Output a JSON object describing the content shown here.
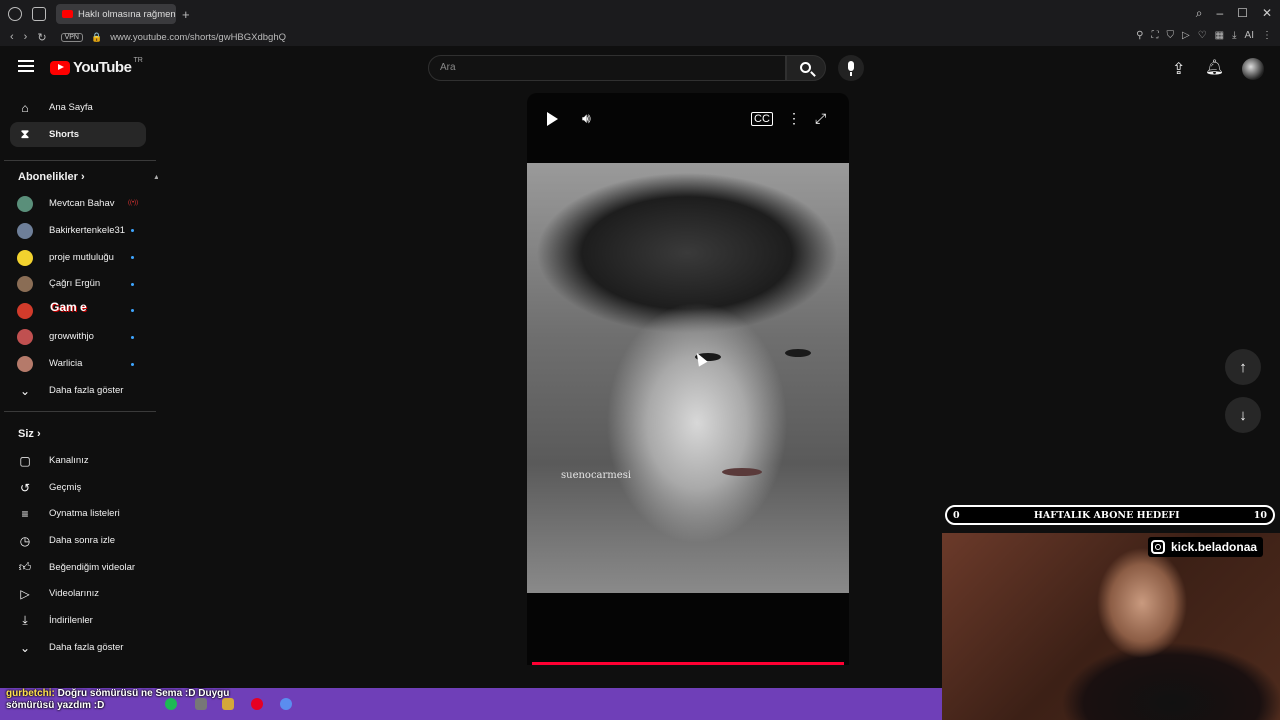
{
  "browser": {
    "tab_title": "Haklı olmasına rağmen üslu",
    "url": "www.youtube.com/shorts/gwHBGXdbghQ",
    "vpn_label": "VPN",
    "ext_ai_label": "AI"
  },
  "header": {
    "logo_text": "YouTube",
    "region": "TR",
    "search_placeholder": "Ara"
  },
  "sidebar": {
    "main": [
      {
        "label": "Ana Sayfa",
        "icon": "home-icon"
      },
      {
        "label": "Shorts",
        "icon": "shorts-icon",
        "active": true
      }
    ],
    "subs_heading": "Abonelikler",
    "subscriptions": [
      {
        "label": "Mevtcan Bahav",
        "color": "#5a8f7a",
        "status": "live"
      },
      {
        "label": "Bakirkertenkele31",
        "color": "#6e7f99"
      },
      {
        "label": "proje mutluluğu",
        "color": "#f2d22e"
      },
      {
        "label": "Çağrı Ergün",
        "color": "#8a6d55"
      },
      {
        "label": "",
        "color": "#d13b2b"
      },
      {
        "label": "growwithjo",
        "color": "#c05050"
      },
      {
        "label": "Warlicia",
        "color": "#b57a6a"
      }
    ],
    "subs_more": "Daha fazla göster",
    "you_heading": "Siz",
    "you_items": [
      {
        "label": "Kanalınız",
        "icon": "channel-icon"
      },
      {
        "label": "Geçmiş",
        "icon": "history-icon"
      },
      {
        "label": "Oynatma listeleri",
        "icon": "playlist-icon"
      },
      {
        "label": "Daha sonra izle",
        "icon": "clock-icon"
      },
      {
        "label": "Beğendiğim videolar",
        "icon": "thumb-up-icon"
      },
      {
        "label": "Videolarınız",
        "icon": "video-icon"
      },
      {
        "label": "İndirilenler",
        "icon": "download-icon"
      },
      {
        "label": "Daha fazla göster",
        "icon": "chevron-down-icon"
      }
    ]
  },
  "player": {
    "watermark": "suenocarmesi",
    "progress": 1.0
  },
  "stream_overlay": {
    "goal_start": "0",
    "goal_label": "HAFTALIK ABONE HEDEFI",
    "goal_end": "10",
    "instagram": "kick.beladonaa",
    "game_text": "Gam e",
    "chat_user": "gurbetchi:",
    "chat_message": "Doğru sömürüsü ne Sema :D Duygu sömürüsü yazdım :D"
  },
  "colors": {
    "accent": "#ff0000",
    "progress": "#ff0033",
    "taskbar": "#6f3fb8",
    "unseen_dot": "#3ea6ff"
  }
}
